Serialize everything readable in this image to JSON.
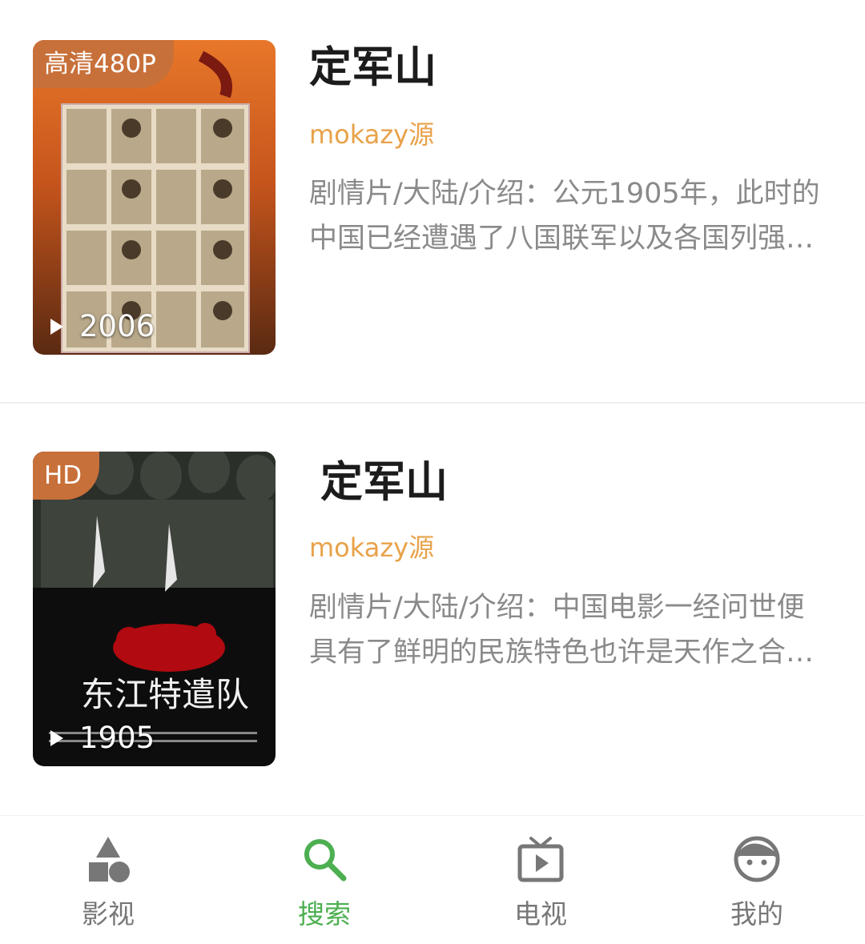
{
  "results": [
    {
      "badge": "高清480P",
      "year": "2006",
      "title": "定军山",
      "source": "mokazy源",
      "description": "剧情片/大陆/介绍：公元1905年，此时的中国已经遭遇了八国联军以及各国列强的侵略…"
    },
    {
      "badge": "HD",
      "year": "1905",
      "title": "定军山",
      "source": "mokazy源",
      "description": "剧情片/大陆/介绍：中国电影一经问世便具有了鲜明的民族特色也许是天作之合…"
    }
  ],
  "tabs": [
    {
      "label": "影视",
      "icon": "shapes-icon"
    },
    {
      "label": "搜索",
      "icon": "search-icon",
      "active": true
    },
    {
      "label": "电视",
      "icon": "tv-icon"
    },
    {
      "label": "我的",
      "icon": "face-icon"
    }
  ],
  "colors": {
    "accent": "#4caf50",
    "source": "#e8a24a",
    "badge": "#c8703a",
    "icon_inactive": "#777777"
  }
}
